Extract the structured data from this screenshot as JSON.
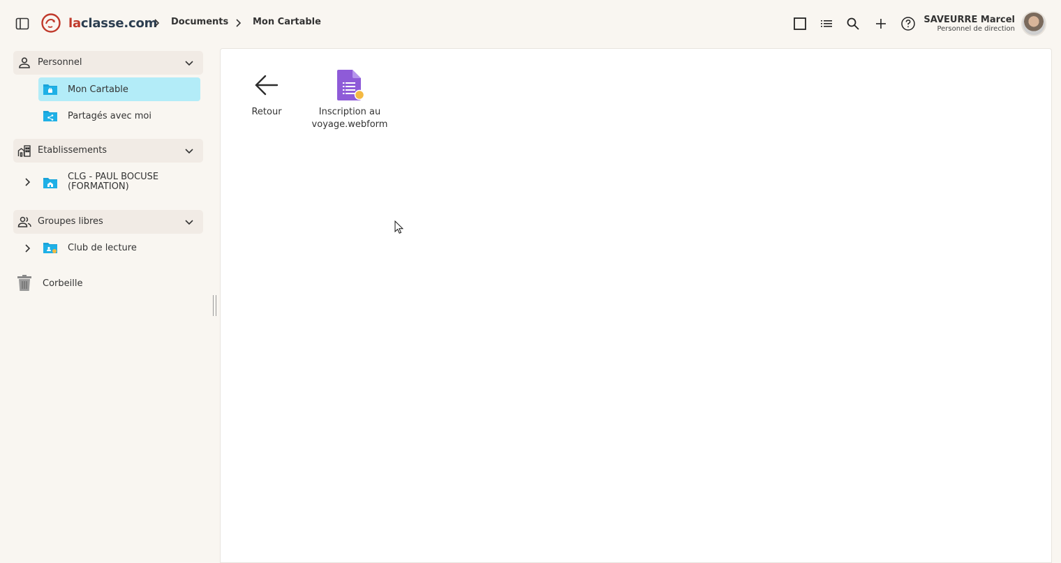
{
  "header": {
    "logo_prefix": "la",
    "logo_suffix": "classe.com",
    "breadcrumbs": [
      "Documents",
      "Mon Cartable"
    ],
    "icons": [
      "view-grid-icon",
      "view-list-icon",
      "search-icon",
      "add-icon",
      "help-icon"
    ],
    "user": {
      "name": "SAVEURRE Marcel",
      "role": "Personnel de direction"
    }
  },
  "sidebar": {
    "sections": [
      {
        "label": "Personnel",
        "icon": "person-icon",
        "items": [
          {
            "label": "Mon Cartable",
            "active": true
          },
          {
            "label": "Partagés avec moi",
            "active": false
          }
        ]
      },
      {
        "label": "Etablissements",
        "icon": "buildings-icon",
        "items": [
          {
            "label": "CLG - PAUL BOCUSE (FORMATION)"
          }
        ]
      },
      {
        "label": "Groupes libres",
        "icon": "group-icon",
        "items": [
          {
            "label": "Club de lecture"
          }
        ]
      }
    ],
    "trash_label": "Corbeille"
  },
  "main": {
    "tiles": [
      {
        "label": "Retour",
        "icon": "arrow-back-icon"
      },
      {
        "label": "Inscription au voyage.webform",
        "icon": "webform-icon"
      }
    ]
  },
  "colors": {
    "brand_red": "#c0392b",
    "active_bg": "#b3ecf8",
    "folder_blue": "#1aa3d9",
    "form_purple": "#8e5bd8",
    "badge_yellow": "#f4b942"
  }
}
